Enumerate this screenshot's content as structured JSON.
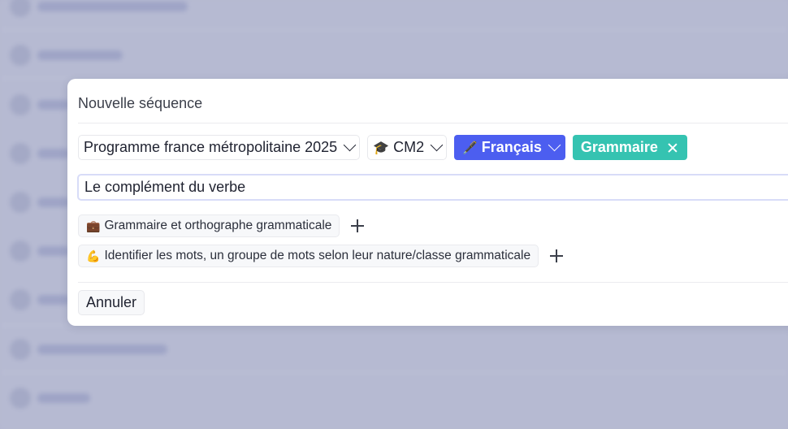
{
  "colors": {
    "backdrop": "#b6bad2",
    "subject_accent": "#4c5ef0",
    "domain_accent": "#35c3b1",
    "input_focus_border": "#d8dcf8"
  },
  "modal": {
    "title": "Nouvelle séquence",
    "program_select": {
      "value": "Programme france métropolitaine 2025",
      "icon": "chevron-down-icon"
    },
    "level_select": {
      "emoji": "🎓",
      "value": "CM2",
      "icon": "chevron-down-icon"
    },
    "subject_select": {
      "emoji": "🖋️",
      "value": "Français",
      "icon": "chevron-down-icon"
    },
    "domain_tag": {
      "label": "Grammaire",
      "icon": "close-icon"
    },
    "title_input": {
      "value": "Le complément du verbe"
    },
    "tags": [
      {
        "emoji": "💼",
        "label": "Grammaire et orthographe grammaticale",
        "icon": "plus-icon"
      },
      {
        "emoji": "💪",
        "label": "Identifier les mots, un groupe de mots selon leur nature/classe grammaticale",
        "icon": "plus-icon"
      }
    ],
    "cancel_label": "Annuler"
  }
}
